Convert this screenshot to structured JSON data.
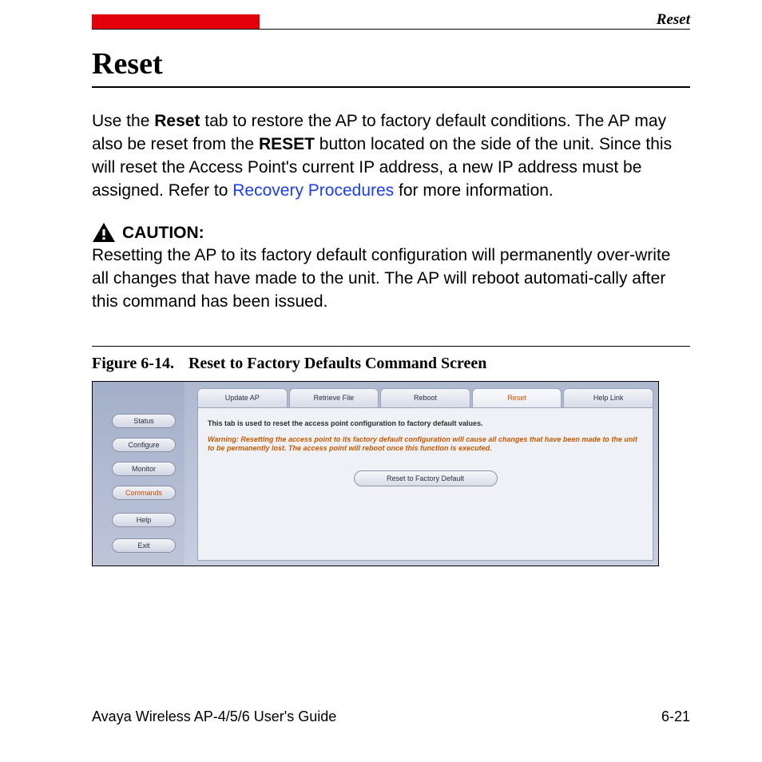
{
  "header": {
    "running_head": "Reset"
  },
  "title": "Reset",
  "paragraph": {
    "pre": "Use the ",
    "b1": "Reset",
    "mid1": " tab to restore the AP to factory default conditions. The AP may also be reset from the ",
    "b2": "RESET",
    "mid2": " button located on the side of the unit. Since this will reset the Access Point's current IP address, a new IP address must be assigned. Refer to ",
    "link": "Recovery Procedures",
    "post": " for more information."
  },
  "caution": {
    "label": "CAUTION:",
    "text": "Resetting the AP to its factory default configuration will permanently over-write all changes that have made to the unit. The AP will reboot automati-cally after this command has been issued."
  },
  "figure": {
    "number": "Figure 6-14.",
    "title": "Reset to Factory Defaults Command Screen"
  },
  "screenshot": {
    "sidebar": [
      "Status",
      "Configure",
      "Monitor",
      "Commands",
      "Help",
      "Exit"
    ],
    "tabs": [
      "Update AP",
      "Retrieve File",
      "Reboot",
      "Reset",
      "Help Link"
    ],
    "active_tab": "Reset",
    "active_side": "Commands",
    "desc": "This tab is used to reset the access point configuration to factory default values.",
    "warn": "Warning: Resetting the access point to its factory default configuration will cause all changes that have been made to the unit to be permanently lost. The access point will reboot once this function is executed.",
    "button": "Reset to Factory Default"
  },
  "footer": {
    "guide": "Avaya Wireless AP-4/5/6 User's Guide",
    "page": "6-21"
  }
}
